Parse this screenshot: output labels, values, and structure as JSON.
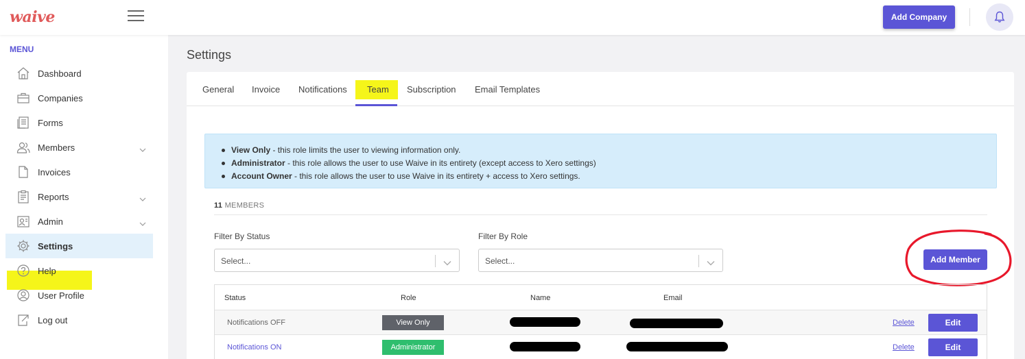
{
  "header": {
    "logo_text": "waive",
    "add_company_label": "Add Company"
  },
  "sidebar": {
    "menu_title": "MENU",
    "items": [
      {
        "label": "Dashboard",
        "icon": "home-icon",
        "has_chevron": false
      },
      {
        "label": "Companies",
        "icon": "briefcase-icon",
        "has_chevron": false
      },
      {
        "label": "Forms",
        "icon": "forms-icon",
        "has_chevron": false
      },
      {
        "label": "Members",
        "icon": "users-icon",
        "has_chevron": true
      },
      {
        "label": "Invoices",
        "icon": "document-icon",
        "has_chevron": false
      },
      {
        "label": "Reports",
        "icon": "clipboard-icon",
        "has_chevron": true
      },
      {
        "label": "Admin",
        "icon": "admin-icon",
        "has_chevron": true
      },
      {
        "label": "Settings",
        "icon": "gear-icon",
        "has_chevron": false,
        "active": true
      },
      {
        "label": "Help",
        "icon": "help-icon",
        "has_chevron": false
      },
      {
        "label": "User Profile",
        "icon": "user-icon",
        "has_chevron": false
      },
      {
        "label": "Log out",
        "icon": "logout-icon",
        "has_chevron": false
      }
    ]
  },
  "page": {
    "title": "Settings"
  },
  "tabs": [
    {
      "label": "General"
    },
    {
      "label": "Invoice"
    },
    {
      "label": "Notifications"
    },
    {
      "label": "Team",
      "active": true
    },
    {
      "label": "Subscription"
    },
    {
      "label": "Email Templates"
    }
  ],
  "info": {
    "items": [
      {
        "role": "View Only",
        "text": " - this role limits the user to viewing information only."
      },
      {
        "role": "Administrator",
        "text": " - this role allows the user to use Waive in its entirety (except access to Xero settings)"
      },
      {
        "role": "Account Owner",
        "text": " - this role allows the user to use Waive in its entirety + access to Xero settings."
      }
    ]
  },
  "members": {
    "count": "11",
    "count_label": " MEMBERS"
  },
  "filters": {
    "status_label": "Filter By Status",
    "status_placeholder": "Select...",
    "role_label": "Filter By Role",
    "role_placeholder": "Select..."
  },
  "add_member_label": "Add Member",
  "table": {
    "headers": {
      "status": "Status",
      "role": "Role",
      "name": "Name",
      "email": "Email"
    },
    "rows": [
      {
        "status": "Notifications OFF",
        "status_color": "#666666",
        "role": "View Only",
        "role_color": "#5f6269",
        "delete": "Delete",
        "edit": "Edit"
      },
      {
        "status": "Notifications ON",
        "status_color": "#5b55d6",
        "role": "Administrator",
        "role_color": "#2fbe6e",
        "delete": "Delete",
        "edit": "Edit"
      }
    ]
  },
  "colors": {
    "accent": "#5b55d6",
    "highlight": "#f5f51a",
    "annotation_circle": "#e8182b",
    "info_bg": "#d6edfb"
  }
}
